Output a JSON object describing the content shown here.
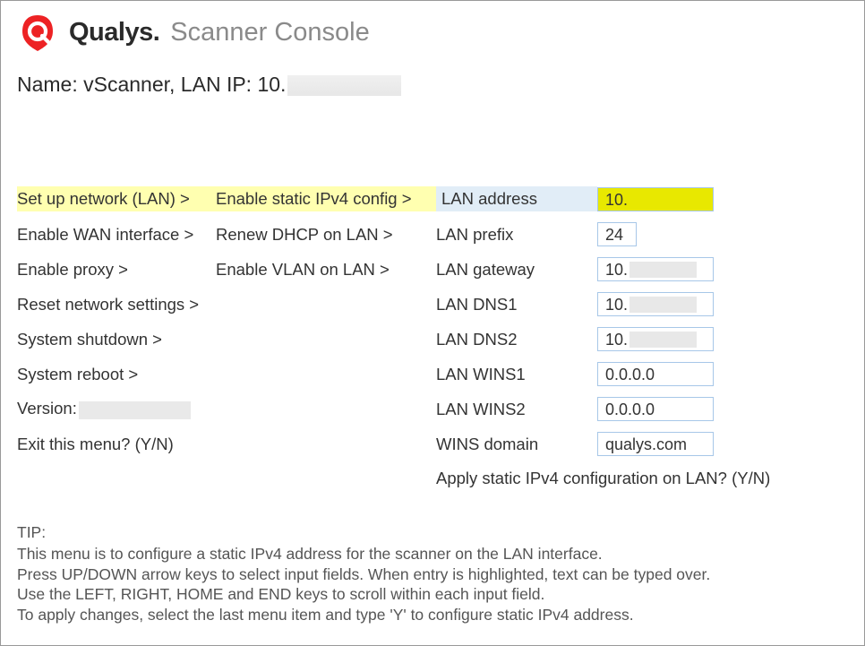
{
  "header": {
    "brand": "Qualys.",
    "title": "Scanner Console"
  },
  "nameLine": {
    "prefix": "Name: vScanner, LAN IP: 10."
  },
  "menu": {
    "col1": [
      "Set up network (LAN) >",
      "Enable WAN interface >",
      "Enable proxy >",
      "Reset network settings >",
      "System shutdown >",
      "System reboot >",
      "Version:",
      "Exit this menu? (Y/N)"
    ],
    "col2": [
      "Enable static IPv4 config >",
      "Renew DHCP on LAN >",
      "Enable VLAN on LAN >"
    ]
  },
  "fields": [
    {
      "label": "LAN address",
      "value": "10.",
      "highlightLabel": true,
      "highlightField": "yellow",
      "redactAfter": false
    },
    {
      "label": "LAN prefix",
      "value": "24",
      "short": true
    },
    {
      "label": "LAN gateway",
      "value": "10.",
      "redactAfter": true
    },
    {
      "label": "LAN DNS1",
      "value": "10.",
      "redactAfter": true
    },
    {
      "label": "LAN DNS2",
      "value": "10.",
      "redactAfter": true
    },
    {
      "label": "LAN WINS1",
      "value": "0.0.0.0"
    },
    {
      "label": "LAN WINS2",
      "value": "0.0.0.0"
    },
    {
      "label": "WINS domain",
      "value": "qualys.com"
    }
  ],
  "applyLine": "Apply static IPv4 configuration on LAN? (Y/N)",
  "tip": {
    "label": "TIP:",
    "lines": [
      "This menu is to configure a static IPv4 address for the scanner on the LAN interface.",
      "Press UP/DOWN arrow keys to select input fields. When entry is highlighted, text can be typed over.",
      "Use the LEFT, RIGHT, HOME and END keys to scroll within each input field.",
      "To apply changes, select the last menu item and type 'Y' to configure static IPv4 address."
    ]
  }
}
